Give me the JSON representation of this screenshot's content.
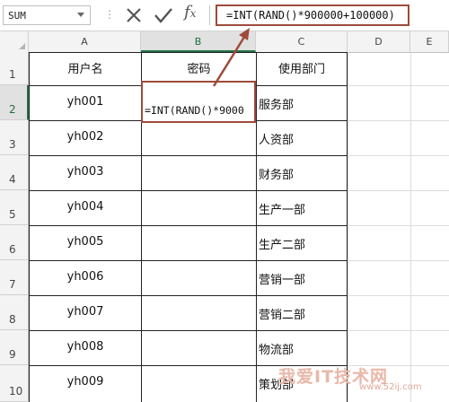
{
  "formula_bar": {
    "name_box": "SUM",
    "separator": "⋮",
    "formula": "=INT(RAND()*900000+100000)"
  },
  "columns": [
    "A",
    "B",
    "C",
    "D",
    "E"
  ],
  "rows": [
    "1",
    "2",
    "3",
    "4",
    "5",
    "6",
    "7",
    "8",
    "9",
    "10"
  ],
  "table": {
    "headers": [
      "用户名",
      "密码",
      "使用部门"
    ],
    "usernames": [
      "yh001",
      "yh002",
      "yh003",
      "yh004",
      "yh005",
      "yh006",
      "yh007",
      "yh008",
      "yh009"
    ],
    "departments": [
      "服务部",
      "人资部",
      "财务部",
      "生产一部",
      "生产二部",
      "营销一部",
      "营销二部",
      "物流部",
      "策划部"
    ]
  },
  "active_cell": {
    "text": "=INT(RAND()*9000"
  },
  "colors": {
    "highlight": "#9e4b3b",
    "excel_green": "#217346"
  },
  "watermark": {
    "main": "我爱IT技术网",
    "sub": "www.52ij.com"
  }
}
